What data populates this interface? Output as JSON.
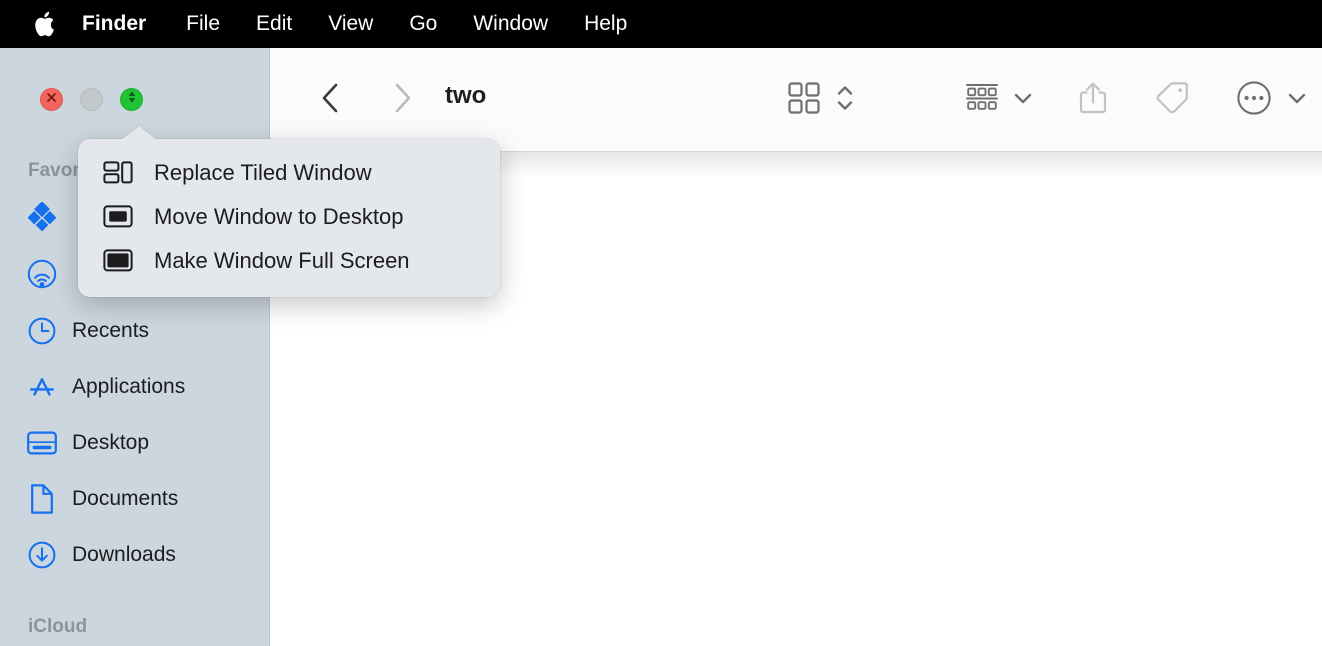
{
  "menubar": {
    "apple_icon": "apple-logo-icon",
    "items": [
      {
        "label": "Finder",
        "bold": true
      },
      {
        "label": "File",
        "bold": false
      },
      {
        "label": "Edit",
        "bold": false
      },
      {
        "label": "View",
        "bold": false
      },
      {
        "label": "Go",
        "bold": false
      },
      {
        "label": "Window",
        "bold": false
      },
      {
        "label": "Help",
        "bold": false
      }
    ]
  },
  "window": {
    "title": "two",
    "traffic_lights": [
      {
        "name": "close-button",
        "color": "#f2655d",
        "glyph": "close-x-icon"
      },
      {
        "name": "minimize-button",
        "color": "#c3c8cb",
        "glyph": "none"
      },
      {
        "name": "maximize-button",
        "color": "#20c333",
        "glyph": "expand-arrows-icon"
      }
    ]
  },
  "toolbar": {
    "back_label": "back-chevron-icon",
    "forward_label": "forward-chevron-icon",
    "title": "two",
    "view_icon": "icon-view-grid-icon",
    "view_stepper": "up-down-chevron-icon",
    "group_icon": "group-by-rows-icon",
    "group_chevron": "chevron-down-icon",
    "share_icon": "share-upload-icon",
    "tag_icon": "tag-icon",
    "more_icon": "more-ellipsis-circle-icon",
    "more_chevron": "chevron-down-icon"
  },
  "sidebar": {
    "sections": [
      {
        "header": "Favorites"
      },
      {
        "header": "iCloud"
      }
    ],
    "items": [
      {
        "label": "",
        "icon": "dropbox-icon"
      },
      {
        "label": "",
        "icon": "airdrop-icon"
      },
      {
        "label": "Recents",
        "icon": "clock-recents-icon"
      },
      {
        "label": "Applications",
        "icon": "applications-icon"
      },
      {
        "label": "Desktop",
        "icon": "desktop-icon"
      },
      {
        "label": "Documents",
        "icon": "documents-icon"
      },
      {
        "label": "Downloads",
        "icon": "downloads-icon"
      }
    ]
  },
  "popup_menu": {
    "items": [
      {
        "label": "Replace Tiled Window",
        "icon": "tiled-window-icon"
      },
      {
        "label": "Move Window to Desktop",
        "icon": "window-desktop-icon"
      },
      {
        "label": "Make Window Full Screen",
        "icon": "fullscreen-icon"
      }
    ]
  },
  "colors": {
    "menubar_bg": "#000000",
    "sidebar_bg": "#ccd6de",
    "toolbar_bg": "#fbfbfb",
    "content_bg": "#ffffff",
    "popup_bg": "#e4e8ec",
    "accent_blue": "#0b78f0"
  }
}
